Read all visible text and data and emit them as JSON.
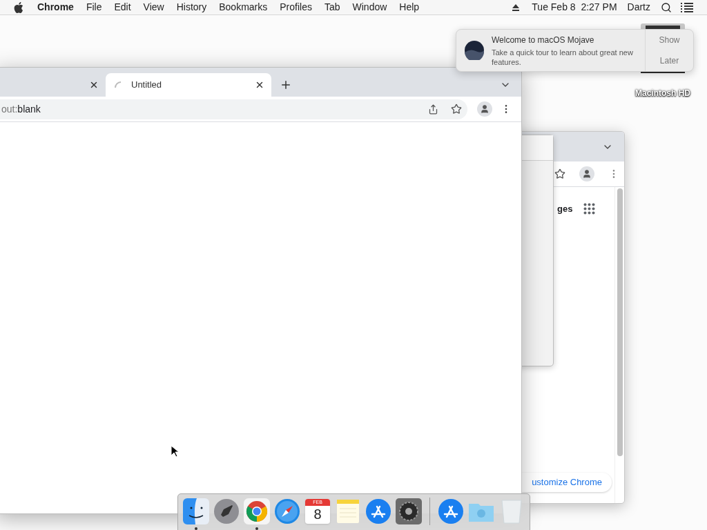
{
  "menu_bar": {
    "app": "Chrome",
    "items": [
      "File",
      "Edit",
      "View",
      "History",
      "Bookmarks",
      "Profiles",
      "Tab",
      "Window",
      "Help"
    ],
    "clock": "Tue Feb 8  2:27 PM",
    "user": "Dartz"
  },
  "notification": {
    "title": "Welcome to macOS Mojave",
    "body": "Take a quick tour to learn about great new features.",
    "actions": [
      "Show",
      "Later"
    ]
  },
  "desktop_icons": [
    {
      "label": "Macintosh HD"
    }
  ],
  "front_window": {
    "tabs": [
      {
        "selected": false,
        "loading": false
      },
      {
        "title": "Untitled",
        "selected": true,
        "loading": true
      }
    ],
    "address": {
      "scheme": "out:",
      "rest": "blank"
    }
  },
  "back_window": {
    "section_text": "ges",
    "customize_button": "ustomize Chrome"
  },
  "dock": [
    {
      "kind": "finder",
      "running": true
    },
    {
      "kind": "launchpad",
      "running": false
    },
    {
      "kind": "chrome",
      "running": true
    },
    {
      "kind": "safari",
      "running": false
    },
    {
      "kind": "calendar",
      "running": false,
      "month": "FEB",
      "day": "8"
    },
    {
      "kind": "notes",
      "running": false
    },
    {
      "kind": "appstore",
      "running": false
    },
    {
      "kind": "settings",
      "running": false
    },
    {
      "kind": "separator"
    },
    {
      "kind": "appstore",
      "running": false
    },
    {
      "kind": "folder",
      "running": false
    },
    {
      "kind": "trash",
      "running": false
    }
  ]
}
